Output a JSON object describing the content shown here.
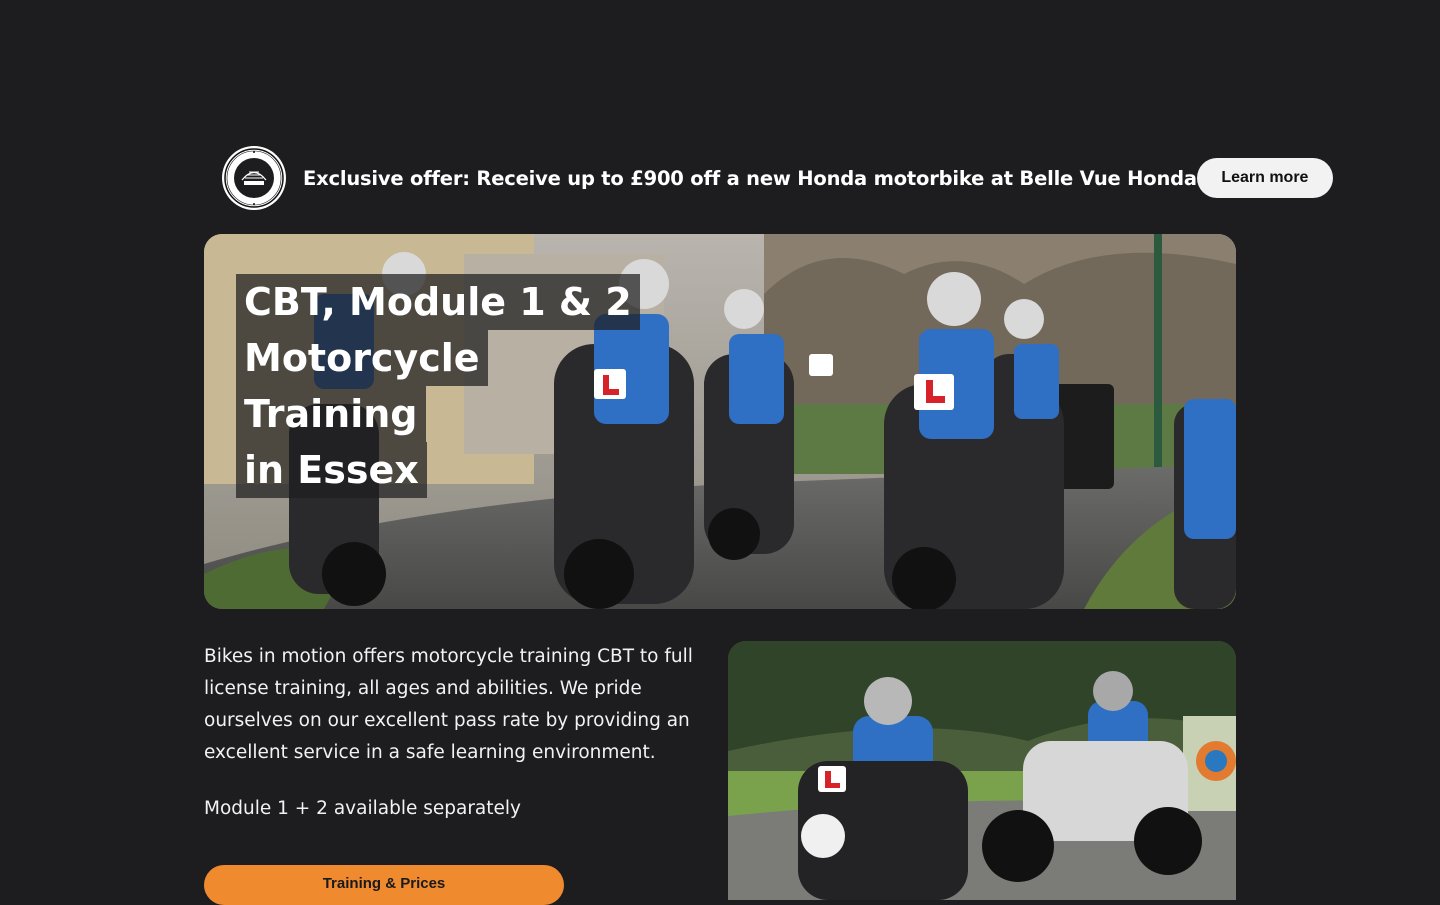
{
  "offer": {
    "badge_text": "APPROVED SCHOOL OF MOTORCYCLING HONDA",
    "text": "Exclusive offer: Receive up to £900 off a new Honda motorbike at Belle Vue Honda",
    "button_label": "Learn more"
  },
  "hero": {
    "title_lines": [
      "CBT, Module 1 & 2",
      "Motorcycle",
      "Training",
      "in Essex"
    ]
  },
  "intro": {
    "paragraph": "Bikes in motion offers motorcycle training CBT to full license training, all ages and abilities. We pride ourselves on our excellent pass rate by providing an excellent service in a safe learning environment.",
    "modules_note": "Module 1 + 2 available separately"
  },
  "cta": {
    "label": "Training & Prices"
  },
  "colors": {
    "background": "#1d1d20",
    "accent": "#f08a2e",
    "button_light": "#f2f2f2"
  },
  "icons": {
    "badge": "honda-approved-school-badge-icon"
  }
}
